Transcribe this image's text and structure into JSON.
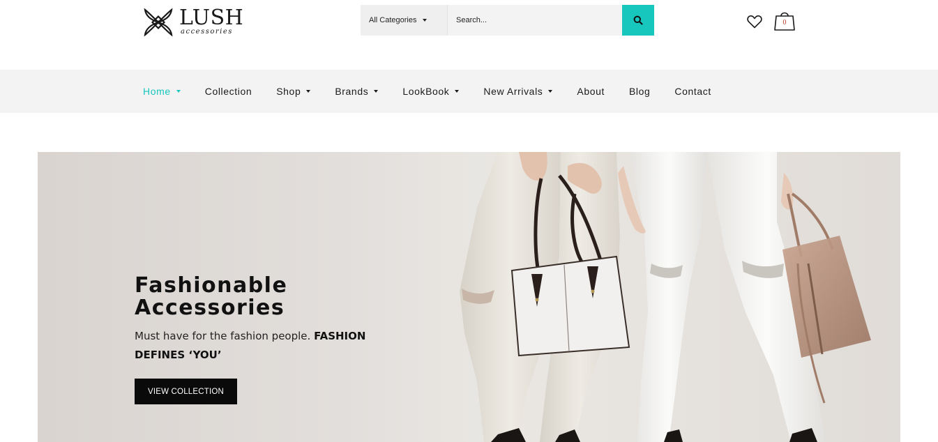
{
  "brand": {
    "name": "LUSH",
    "sub": "accessories"
  },
  "search": {
    "category_label": "All Categories",
    "placeholder": "Search..."
  },
  "cart": {
    "count": "0"
  },
  "nav": {
    "items": [
      {
        "label": "Home"
      },
      {
        "label": "Collection"
      },
      {
        "label": "Shop"
      },
      {
        "label": "Brands"
      },
      {
        "label": "LookBook"
      },
      {
        "label": "New Arrivals"
      },
      {
        "label": "About"
      },
      {
        "label": "Blog"
      },
      {
        "label": "Contact"
      }
    ]
  },
  "hero": {
    "title_line1": "Fashionable",
    "title_line2": "Accessories",
    "subtitle_regular": "Must have for the fashion people. ",
    "subtitle_bold": "FASHION DEFINES ‘YOU’",
    "button_label": "VIEW COLLECTION"
  },
  "colors": {
    "accent": "#17c6bd",
    "nav_bg": "#f3f3f3",
    "button": "#0a0a0a"
  },
  "icons": [
    "logo-mark-icon",
    "caret-down-icon",
    "search-icon",
    "heart-icon",
    "shopping-bag-icon"
  ]
}
